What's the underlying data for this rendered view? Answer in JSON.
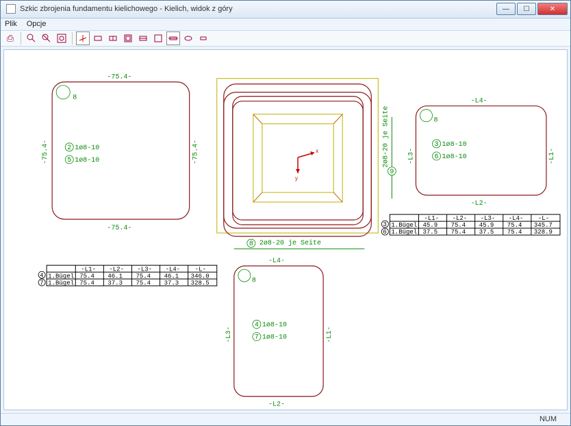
{
  "window": {
    "title": "Szkic zbrojenia fundamentu kielichowego - Kielich, widok z góry"
  },
  "menu": {
    "file": "Plik",
    "options": "Opcje"
  },
  "status": {
    "num": "NUM"
  },
  "toolbar": {
    "print": "print-icon",
    "zoomin": "zoom-in-icon",
    "zoomout": "zoom-out-icon",
    "fit": "zoom-fit-icon",
    "axes": "axes-icon",
    "v1": "view1-icon",
    "v2": "view2-icon",
    "v3": "view3-icon",
    "v4": "view4-icon",
    "v5": "view5-icon",
    "sec": "section-icon",
    "oval": "oval-icon",
    "rect": "rect-icon"
  },
  "shapes": {
    "tl": {
      "top_dim": "-75.4-",
      "left_dim": "-75.4-",
      "right_dim": "-75.4-",
      "bot_dim": "-75.4-",
      "corner": "8",
      "refs": [
        {
          "n": "2",
          "t": "1ø8-10"
        },
        {
          "n": "5",
          "t": "1ø8-10"
        }
      ]
    },
    "center": {
      "right_side": "2ø8-20 je Seite",
      "right_n": "9",
      "bot": "2ø8-20 je Seite",
      "bot_n": "8",
      "axes": {
        "x": "x",
        "y": "y"
      }
    },
    "tr": {
      "top_dim": "-L4-",
      "right_dim": "-L1-",
      "left_dim": "-L3-",
      "bot_dim": "-L2-",
      "corner": "8",
      "refs": [
        {
          "n": "3",
          "t": "1ø8-10"
        },
        {
          "n": "6",
          "t": "1ø8-10"
        }
      ]
    },
    "bl": {
      "top_dim": "-L4-",
      "right_dim": "-L1-",
      "left_dim": "-L3-",
      "bot_dim": "-L2-",
      "corner": "8",
      "refs": [
        {
          "n": "4",
          "t": "1ø8-10"
        },
        {
          "n": "7",
          "t": "1ø8-10"
        }
      ]
    }
  },
  "table_right": {
    "row_ids": [
      "3",
      "6"
    ],
    "headers": [
      "-L1-",
      "-L2-",
      "-L3-",
      "-L4-",
      "-L-"
    ],
    "rows": [
      {
        "label": "1.Bügel",
        "v": [
          "45.9",
          "75.4",
          "45.9",
          "75.4",
          "345.7"
        ]
      },
      {
        "label": "1.Bügel",
        "v": [
          "37.5",
          "75.4",
          "37.5",
          "75.4",
          "328.9"
        ]
      }
    ]
  },
  "table_bot": {
    "row_ids": [
      "4",
      "7"
    ],
    "headers": [
      "-L1-",
      "-L2-",
      "-L3-",
      "-L4-",
      "-L-"
    ],
    "rows": [
      {
        "label": "1.Bügel",
        "v": [
          "75.4",
          "46.1",
          "75.4",
          "46.1",
          "346.0"
        ]
      },
      {
        "label": "1.Bügel",
        "v": [
          "75.4",
          "37.3",
          "75.4",
          "37.3",
          "328.5"
        ]
      }
    ]
  }
}
